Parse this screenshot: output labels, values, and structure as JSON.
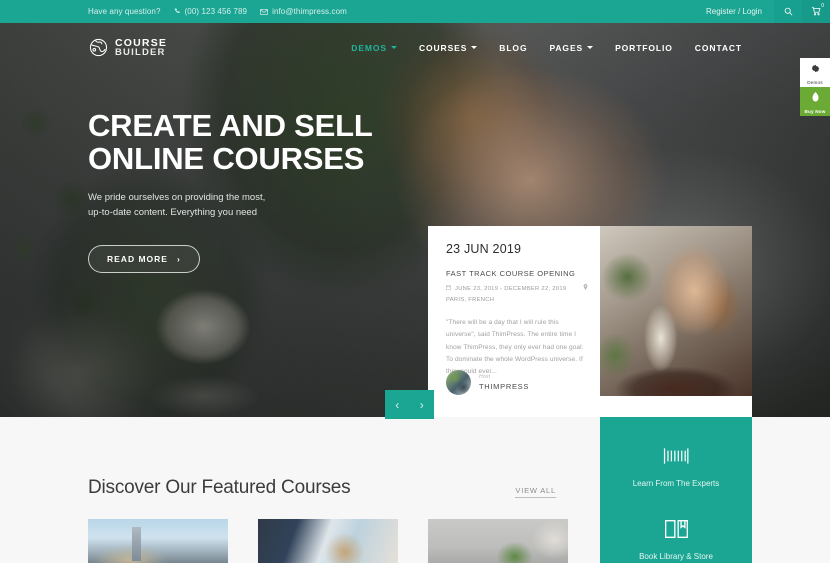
{
  "topbar": {
    "question": "Have any question?",
    "phone": "(00) 123 456 789",
    "email": "info@thimpress.com",
    "register_login": "Register / Login",
    "search_icon": "search-icon",
    "cart_icon": "cart-icon",
    "cart_count": "0"
  },
  "brand": {
    "line1": "COURSE",
    "line2": "BUILDER",
    "logo_icon": "globe-logo-icon"
  },
  "nav": {
    "items": [
      {
        "label": "DEMOS",
        "has_caret": true,
        "active": true
      },
      {
        "label": "COURSES",
        "has_caret": true,
        "active": false
      },
      {
        "label": "BLOG",
        "has_caret": false,
        "active": false
      },
      {
        "label": "PAGES",
        "has_caret": true,
        "active": false
      },
      {
        "label": "PORTFOLIO",
        "has_caret": false,
        "active": false
      },
      {
        "label": "CONTACT",
        "has_caret": false,
        "active": false
      }
    ]
  },
  "hero": {
    "title_line1": "CREATE AND SELL",
    "title_line2": "ONLINE COURSES",
    "sub_line1": "We pride ourselves on providing the most,",
    "sub_line2": "up-to-date content. Everything you need",
    "cta": "READ MORE",
    "cta_arrow": "›",
    "prev_arrow": "‹",
    "next_arrow": "›"
  },
  "event_card": {
    "date": "23 JUN 2019",
    "title": "FAST TRACK COURSE OPENING",
    "meta_dates": "JUNE 23, 2019 - DECEMBER 22, 2019",
    "meta_location": "PARIS, FRENCH",
    "calendar_icon": "calendar-icon",
    "pin_icon": "map-pin-icon",
    "quote": "\"There will be a day that I will rule this universe\", said ThimPress. The entire time I know ThimPress, they only ever had one goal: To dominate the whole WordPress universe. If they could ever...",
    "host_label": "Host",
    "host_name": "THIMPRESS"
  },
  "featured": {
    "heading": "Discover Our Featured Courses",
    "view_all": "VIEW ALL",
    "cards": [
      {
        "name": "course-card-1"
      },
      {
        "name": "course-card-2"
      },
      {
        "name": "course-card-3"
      }
    ]
  },
  "green_panel": {
    "items": [
      {
        "icon": "barcode-icon",
        "label": "Learn From The Experts"
      },
      {
        "icon": "open-book-icon",
        "label": "Book Library & Store"
      }
    ]
  },
  "float_buttons": {
    "demos": {
      "icon": "gear-icon",
      "label": "Demos"
    },
    "buy": {
      "icon": "leaf-icon",
      "label": "Buy Now"
    }
  },
  "colors": {
    "teal": "#1ba694",
    "teal_accent": "#21b39d",
    "green_buy": "#6aaa35",
    "light_bg": "#f7f7f7"
  }
}
